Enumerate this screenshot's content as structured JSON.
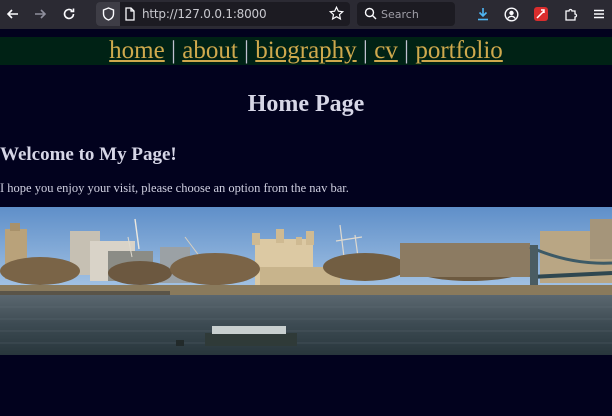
{
  "browser": {
    "url": "http://127.0.0.1:8000",
    "search_placeholder": "Search"
  },
  "nav": {
    "links": [
      "home",
      "about",
      "biography",
      "cv",
      "portfolio"
    ],
    "separator": "|"
  },
  "page": {
    "title": "Home Page",
    "welcome": "Welcome to My Page!",
    "intro": "I hope you enjoy your visit, please choose an option from the nav bar."
  },
  "image": {
    "description_icon": "panorama-photo"
  },
  "colors": {
    "background": "#02021e",
    "nav_background": "#002215",
    "link": "#cfa94d",
    "text": "#d6d6e6"
  }
}
